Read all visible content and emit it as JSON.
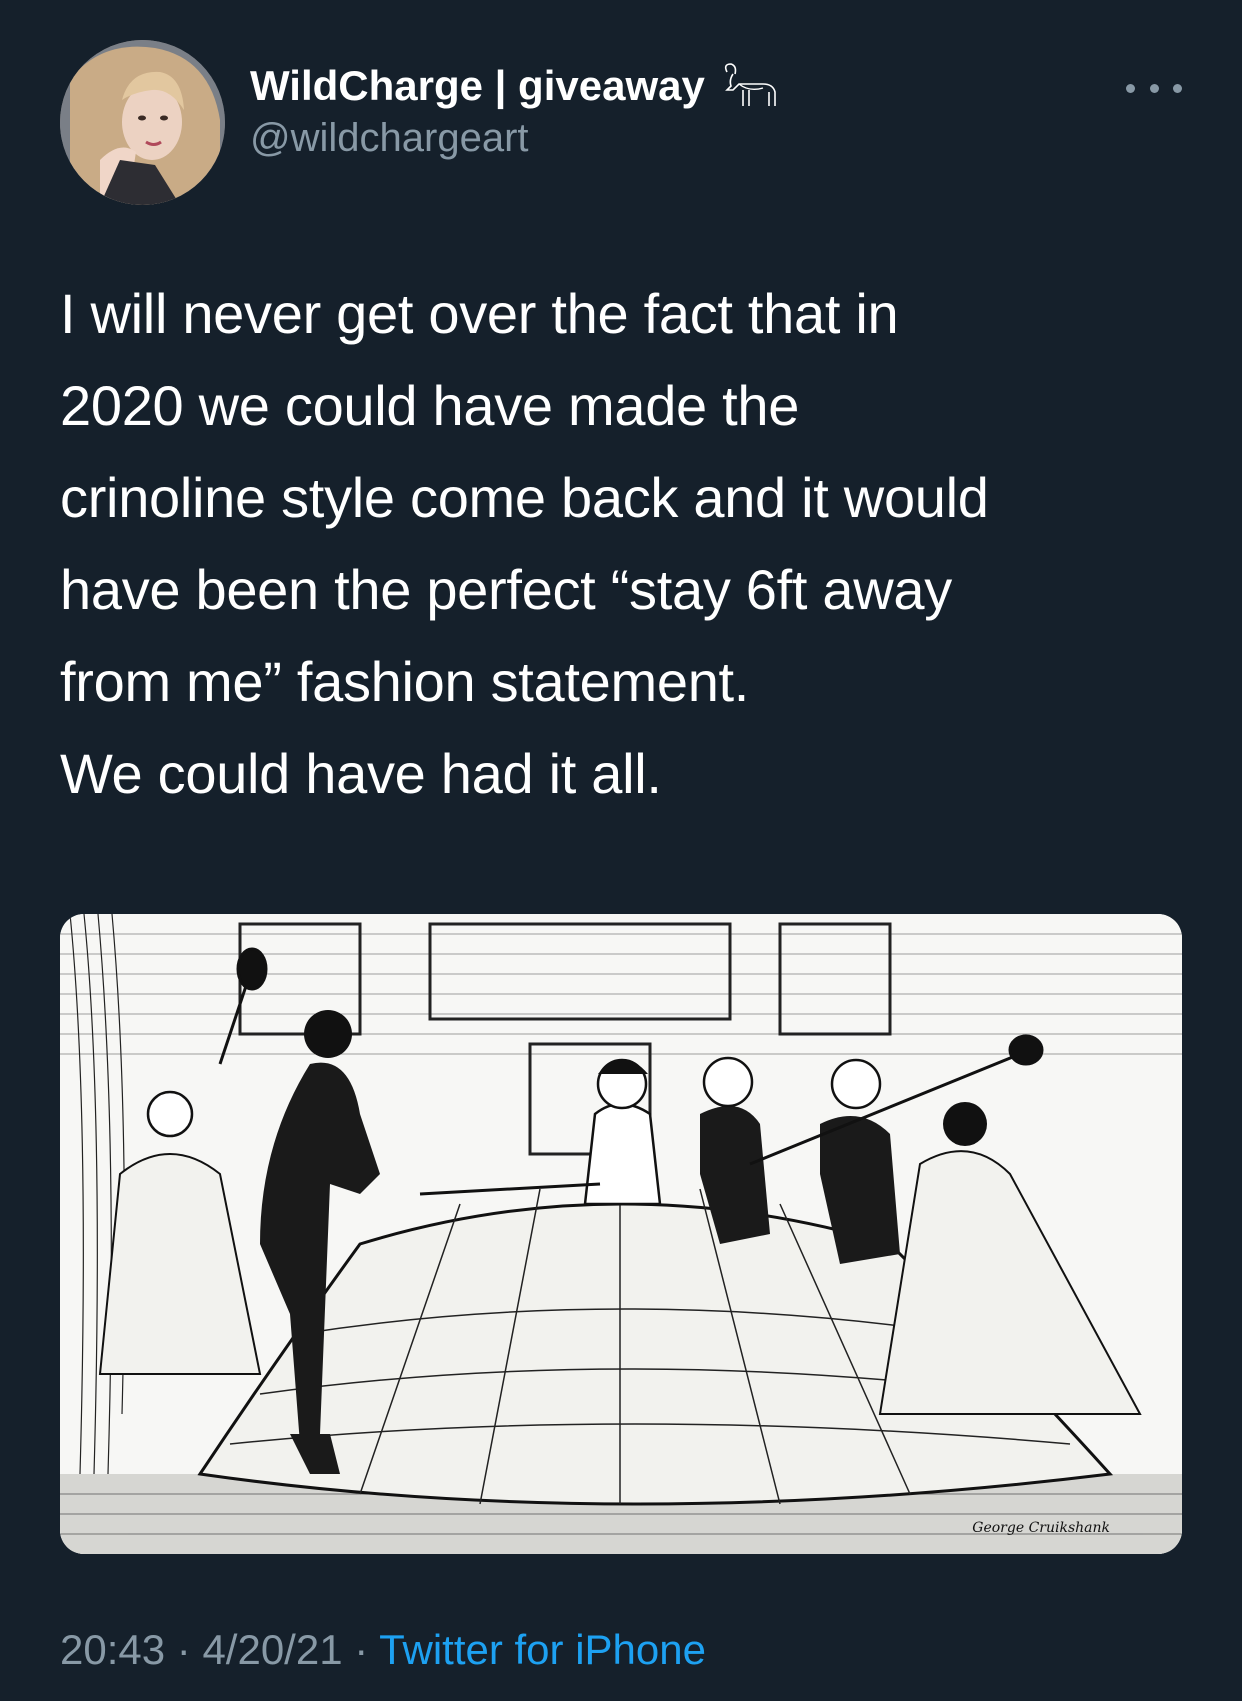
{
  "user": {
    "display_name": "WildCharge | giveaway",
    "handle": "@wildchargeart",
    "badge_icon": "goat-icon"
  },
  "tweet": {
    "lines": [
      "I will never get over the fact that in",
      "2020 we could have made the",
      "crinoline style come back and it would",
      "have been the perfect “stay 6ft away",
      "from me” fashion statement.",
      "We could have had it all."
    ],
    "media": {
      "signature": "George Cruikshank"
    }
  },
  "footer": {
    "time": "20:43",
    "separator": " · ",
    "date": "4/20/21",
    "source": "Twitter for iPhone"
  },
  "colors": {
    "background": "#15202b",
    "secondary_text": "#8899a6",
    "accent": "#1da1f2"
  }
}
